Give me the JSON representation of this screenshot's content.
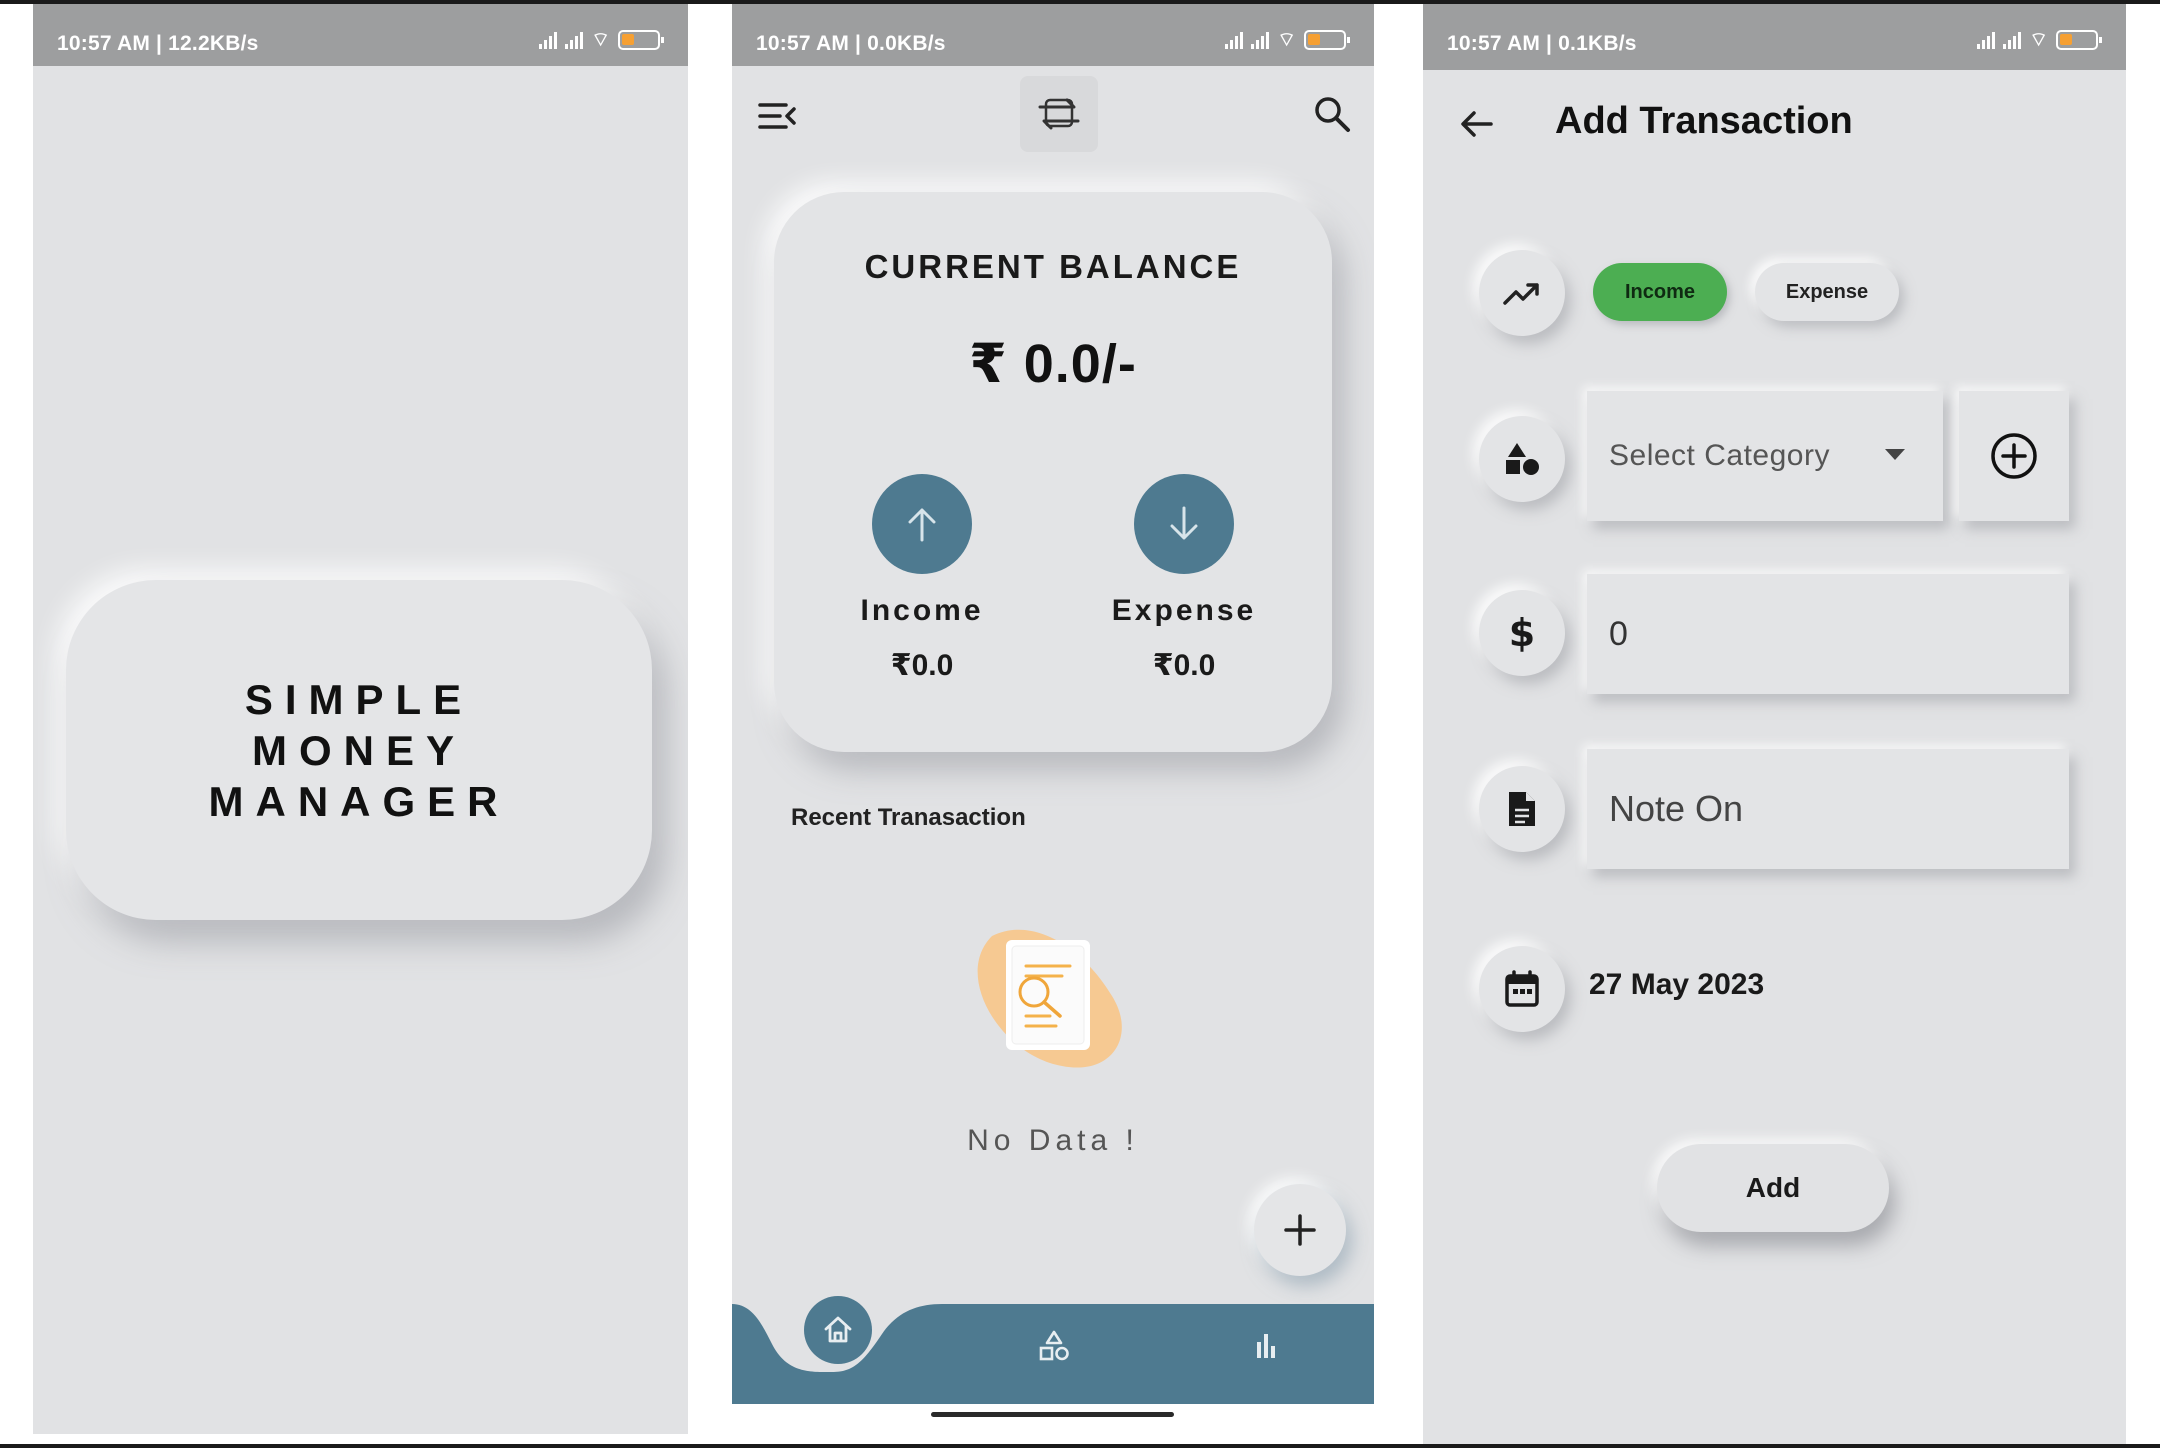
{
  "screen1": {
    "status_text": "10:57 AM | 12.2KB/s",
    "splash_line1": "SIMPLE",
    "splash_line2": "MONEY",
    "splash_line3": "MANAGER"
  },
  "screen2": {
    "status_text": "10:57 AM | 0.0KB/s",
    "balance_title": "CURRENT BALANCE",
    "balance_amount": "₹ 0.0/-",
    "income_label": "Income",
    "income_value": "₹0.0",
    "expense_label": "Expense",
    "expense_value": "₹0.0",
    "recent_heading": "Recent Tranasaction",
    "empty_text": "No Data !",
    "accent_color": "#4e7a90",
    "icons": [
      "menu-icon",
      "exchange-icon",
      "search-icon",
      "arrow-up-icon",
      "arrow-down-icon",
      "plus-icon",
      "home-icon",
      "category-icon",
      "bar-chart-icon"
    ]
  },
  "screen3": {
    "status_text": "10:57 AM | 0.1KB/s",
    "title": "Add Transaction",
    "type_income": "Income",
    "type_expense": "Expense",
    "category_placeholder": "Select Category",
    "amount_value": "0",
    "note_placeholder": "Note On",
    "date": "27 May 2023",
    "add_label": "Add",
    "income_color": "#4cae52",
    "icons": [
      "back-arrow-icon",
      "trend-icon",
      "shapes-icon",
      "dollar-icon",
      "document-icon",
      "calendar-icon",
      "add-circle-icon",
      "dropdown-icon"
    ]
  }
}
